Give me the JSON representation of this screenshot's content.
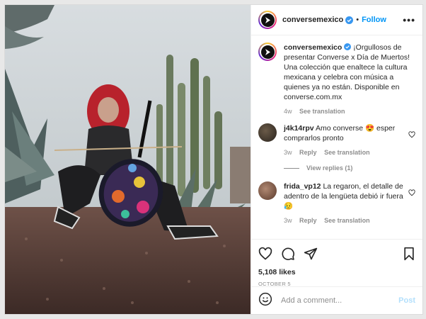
{
  "post": {
    "username": "conversemexico",
    "follow_label": "Follow",
    "more_label": "•••",
    "caption_user": "conversemexico",
    "caption_text": "¡Orgullosos de presentar Converse x Día de Muertos! Una colección que enaltece la cultura mexicana y celebra con música a quienes ya no están. Disponible en converse.com.mx",
    "caption_time": "4w",
    "see_translation": "See translation",
    "likes": "5,108 likes",
    "date": "OCTOBER 5",
    "add_comment_placeholder": "Add a comment...",
    "post_label": "Post"
  },
  "comments": [
    {
      "username": "j4k14rpv",
      "text_before": "Amo converse ",
      "emoji": "😍",
      "text_after": " esper comprarlos pronto",
      "time": "3w",
      "reply": "Reply",
      "see_translation": "See translation",
      "view_replies": "View replies (1)"
    },
    {
      "username": "frida_vp12",
      "text_before": "La regaron, el detalle de adentro de la lengüeta debió ir fuera ",
      "emoji": "😥",
      "text_after": "",
      "time": "3w",
      "reply": "Reply",
      "see_translation": "See translation"
    }
  ],
  "colors": {
    "accent": "#0095f6",
    "post_disabled": "#b2dffc",
    "muted": "#8e8e8e"
  },
  "icons": [
    "verified-icon",
    "heart-icon",
    "comment-icon",
    "share-icon",
    "bookmark-icon",
    "emoji-icon",
    "more-icon"
  ]
}
